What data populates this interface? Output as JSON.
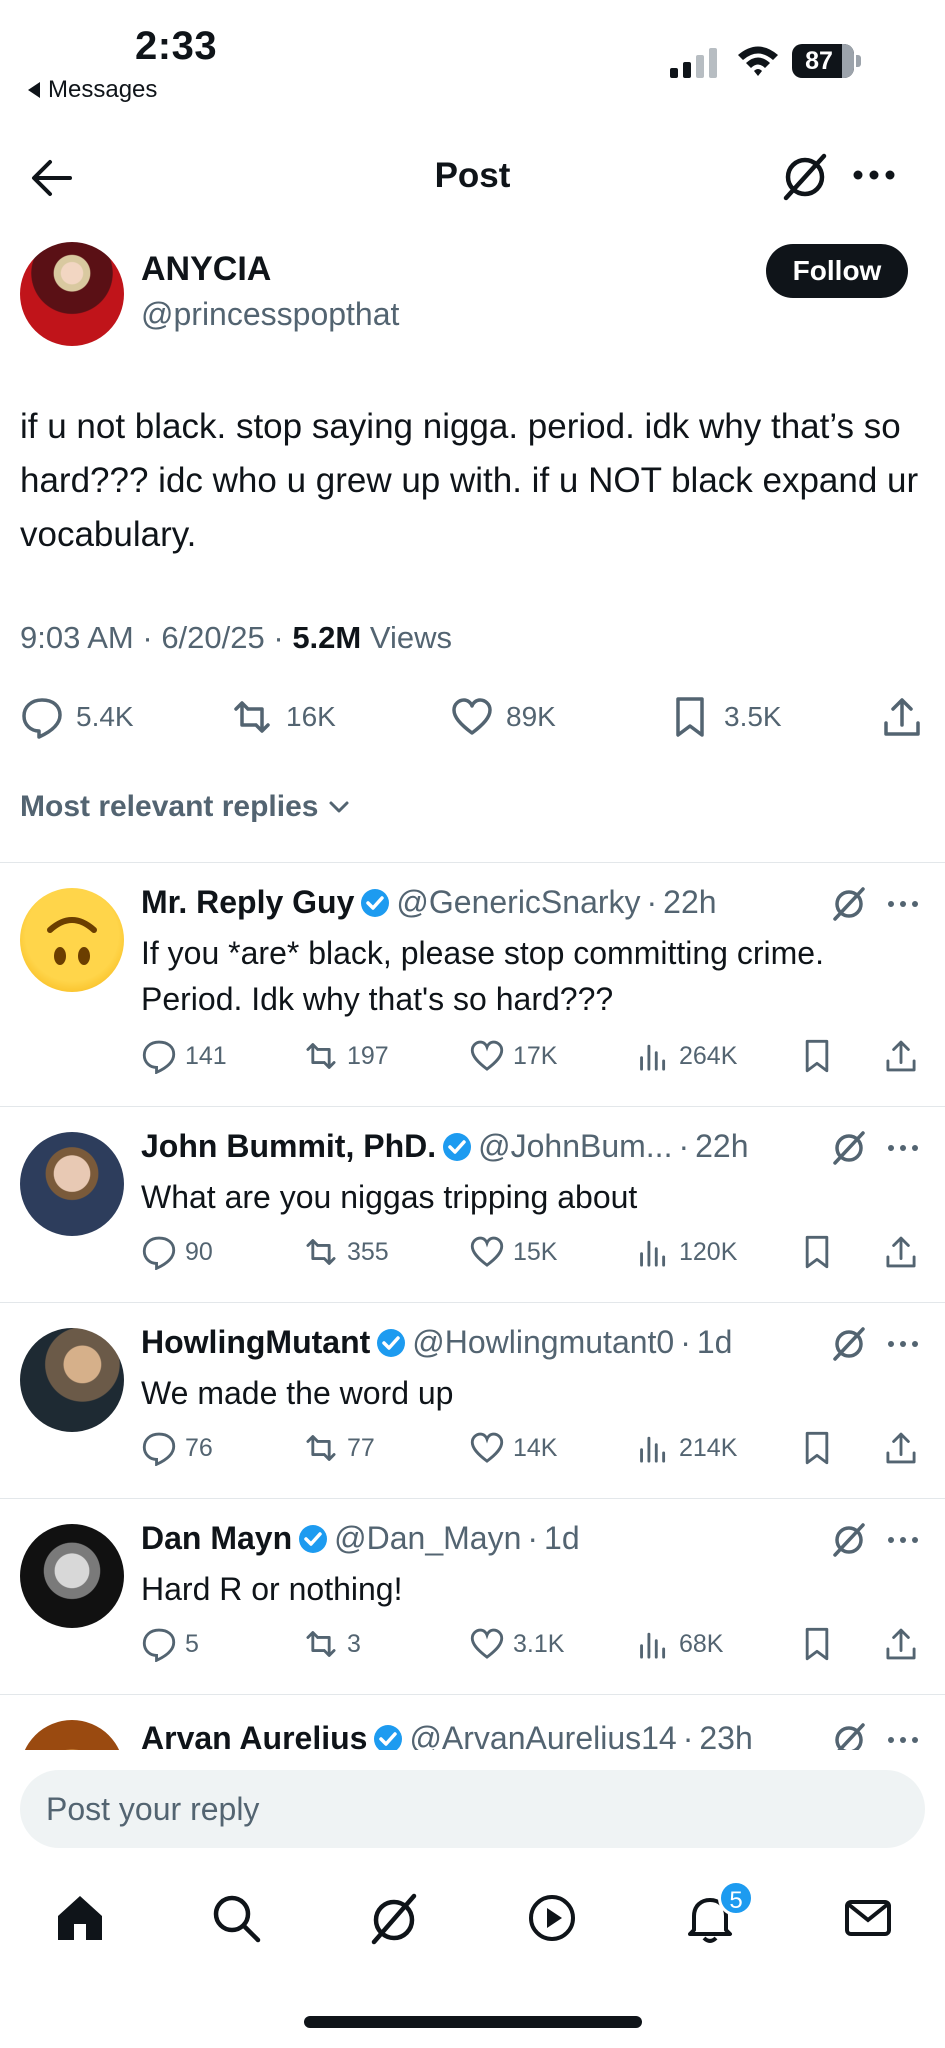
{
  "status_bar": {
    "time": "2:33",
    "back_app": "Messages",
    "battery": "87"
  },
  "header": {
    "title": "Post"
  },
  "author": {
    "name": "ANYCIA",
    "handle": "@princesspopthat",
    "follow_label": "Follow"
  },
  "tweet": {
    "text": "if u not black. stop saying nigga. period. idk why that’s so hard??? idc who u grew up with. if u NOT black expand ur vocabulary.",
    "time": "9:03 AM",
    "date": "6/20/25",
    "views": "5.2M",
    "views_label": "Views"
  },
  "actions": {
    "replies": "5.4K",
    "reposts": "16K",
    "likes": "89K",
    "bookmarks": "3.5K"
  },
  "sort_label": "Most relevant replies",
  "replies": [
    {
      "name": "Mr. Reply Guy",
      "handle": "@GenericSnarky",
      "time": "22h",
      "text": "If you *are* black, please stop committing crime. Period. Idk why that's so hard???",
      "replies": "141",
      "reposts": "197",
      "likes": "17K",
      "views": "264K"
    },
    {
      "name": "John Bummit, PhD.",
      "handle": "@JohnBum...",
      "time": "22h",
      "text": "What are you niggas tripping about",
      "replies": "90",
      "reposts": "355",
      "likes": "15K",
      "views": "120K"
    },
    {
      "name": "HowlingMutant",
      "handle": "@Howlingmutant0",
      "time": "1d",
      "text": "We made the word up",
      "replies": "76",
      "reposts": "77",
      "likes": "14K",
      "views": "214K"
    },
    {
      "name": "Dan Mayn",
      "handle": "@Dan_Mayn",
      "time": "1d",
      "text": "Hard R or nothing!",
      "replies": "5",
      "reposts": "3",
      "likes": "3.1K",
      "views": "68K"
    },
    {
      "name": "Arvan Aurelius",
      "handle": "@ArvanAurelius14",
      "time": "23h"
    }
  ],
  "composer": {
    "placeholder": "Post your reply"
  },
  "tabbar": {
    "notifications_count": "5"
  },
  "colors": {
    "accent": "#1d9bf0",
    "text": "#0f1419",
    "muted": "#536471"
  }
}
